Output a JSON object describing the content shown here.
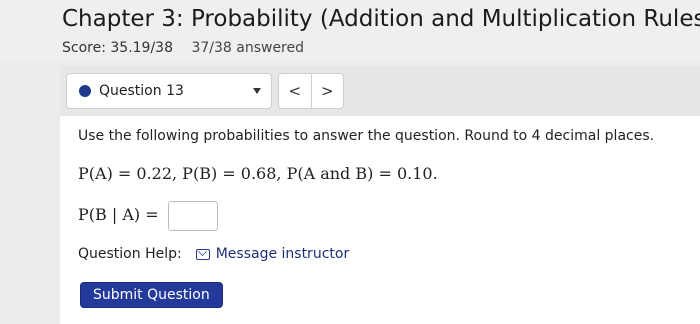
{
  "header": {
    "title": "Chapter 3: Probability (Addition and Multiplication Rules)",
    "score_label": "Score: 35.19/38",
    "answered": "37/38 answered"
  },
  "nav": {
    "question_label": "Question 13",
    "prev": "<",
    "next": ">"
  },
  "question": {
    "instructions": "Use the following probabilities to answer the question. Round to 4 decimal places.",
    "given": "P(A) = 0.22, P(B) = 0.68, P(A and B) = 0.10.",
    "prompt": "P(B | A) =",
    "answer_value": ""
  },
  "help": {
    "label": "Question Help:",
    "message_link": "Message instructor"
  },
  "submit_label": "Submit Question",
  "colors": {
    "accent": "#233a9b",
    "dot": "#1e3a8a"
  },
  "icons": {
    "mail": "mail-icon",
    "dropdown": "chevron-down-icon"
  }
}
